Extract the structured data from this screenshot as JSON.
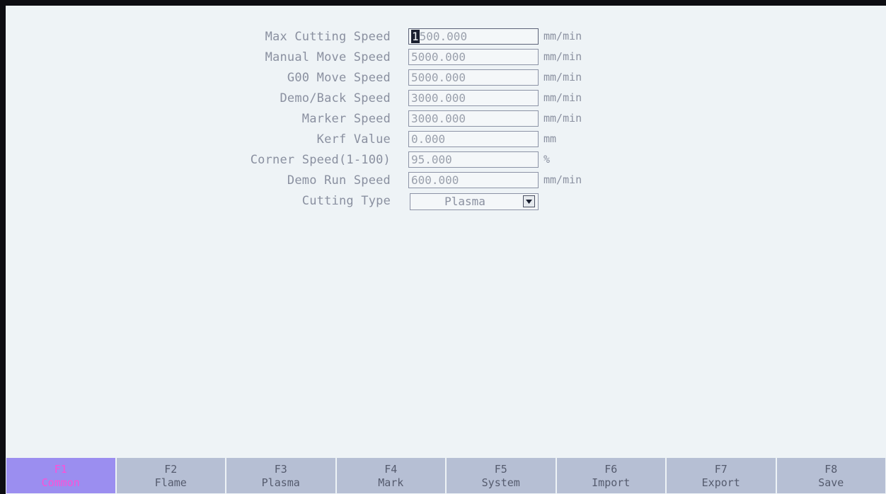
{
  "fields": [
    {
      "label": "Max Cutting Speed",
      "cursor": "1",
      "value": "500.000",
      "unit": "mm/min"
    },
    {
      "label": "Manual Move Speed",
      "cursor": "",
      "value": "5000.000",
      "unit": "mm/min"
    },
    {
      "label": "G00 Move Speed",
      "cursor": "",
      "value": "5000.000",
      "unit": "mm/min"
    },
    {
      "label": "Demo/Back Speed",
      "cursor": "",
      "value": "3000.000",
      "unit": "mm/min"
    },
    {
      "label": "Marker Speed",
      "cursor": "",
      "value": "3000.000",
      "unit": "mm/min"
    },
    {
      "label": "Kerf Value",
      "cursor": "",
      "value": "0.000",
      "unit": "mm"
    },
    {
      "label": "Corner Speed(1-100)",
      "cursor": "",
      "value": "95.000",
      "unit": "%"
    },
    {
      "label": "Demo Run Speed",
      "cursor": "",
      "value": "600.000",
      "unit": "mm/min"
    }
  ],
  "cutting_type": {
    "label": "Cutting Type",
    "value": "Plasma"
  },
  "function_keys": [
    {
      "key": "F1",
      "name": "Common",
      "active": true
    },
    {
      "key": "F2",
      "name": "Flame",
      "active": false
    },
    {
      "key": "F3",
      "name": "Plasma",
      "active": false
    },
    {
      "key": "F4",
      "name": "Mark",
      "active": false
    },
    {
      "key": "F5",
      "name": "System",
      "active": false
    },
    {
      "key": "F6",
      "name": "Import",
      "active": false
    },
    {
      "key": "F7",
      "name": "Export",
      "active": false
    },
    {
      "key": "F8",
      "name": "Save",
      "active": false
    }
  ],
  "colors": {
    "active_tab_bg": "#9b8ef0",
    "active_tab_text": "#ff4fd8",
    "tab_bg": "#b6bfd4",
    "screen_bg": "#eef3f6"
  }
}
